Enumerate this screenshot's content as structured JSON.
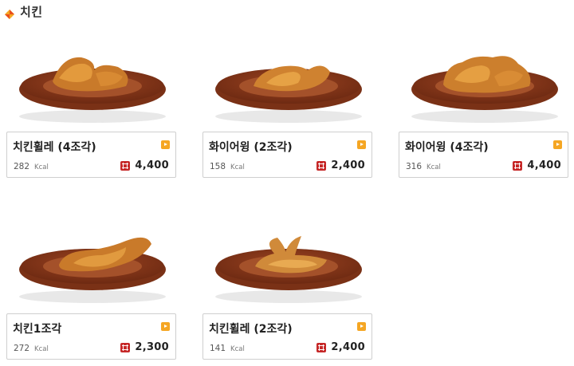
{
  "header": {
    "title": "치킨",
    "icon": "diamond-icon",
    "icon_colors": [
      "#e94e1b",
      "#f5a623"
    ]
  },
  "products": [
    {
      "name": "치킨휠레 (4조각)",
      "kcal": "282",
      "kcal_unit": "Kcal",
      "price": "4,400"
    },
    {
      "name": "화이어윙 (2조각)",
      "kcal": "158",
      "kcal_unit": "Kcal",
      "price": "2,400"
    },
    {
      "name": "화이어윙 (4조각)",
      "kcal": "316",
      "kcal_unit": "Kcal",
      "price": "4,400"
    },
    {
      "name": "치킨1조각",
      "kcal": "272",
      "kcal_unit": "Kcal",
      "price": "2,300"
    },
    {
      "name": "치킨휠레 (2조각)",
      "kcal": "141",
      "kcal_unit": "Kcal",
      "price": "2,400"
    }
  ],
  "colors": {
    "plate": "#8b3a1e",
    "plate_rim": "#b5532a",
    "chicken": "#d9892f",
    "detail_arrow": "#f5a623",
    "won_badge": "#c62828"
  }
}
